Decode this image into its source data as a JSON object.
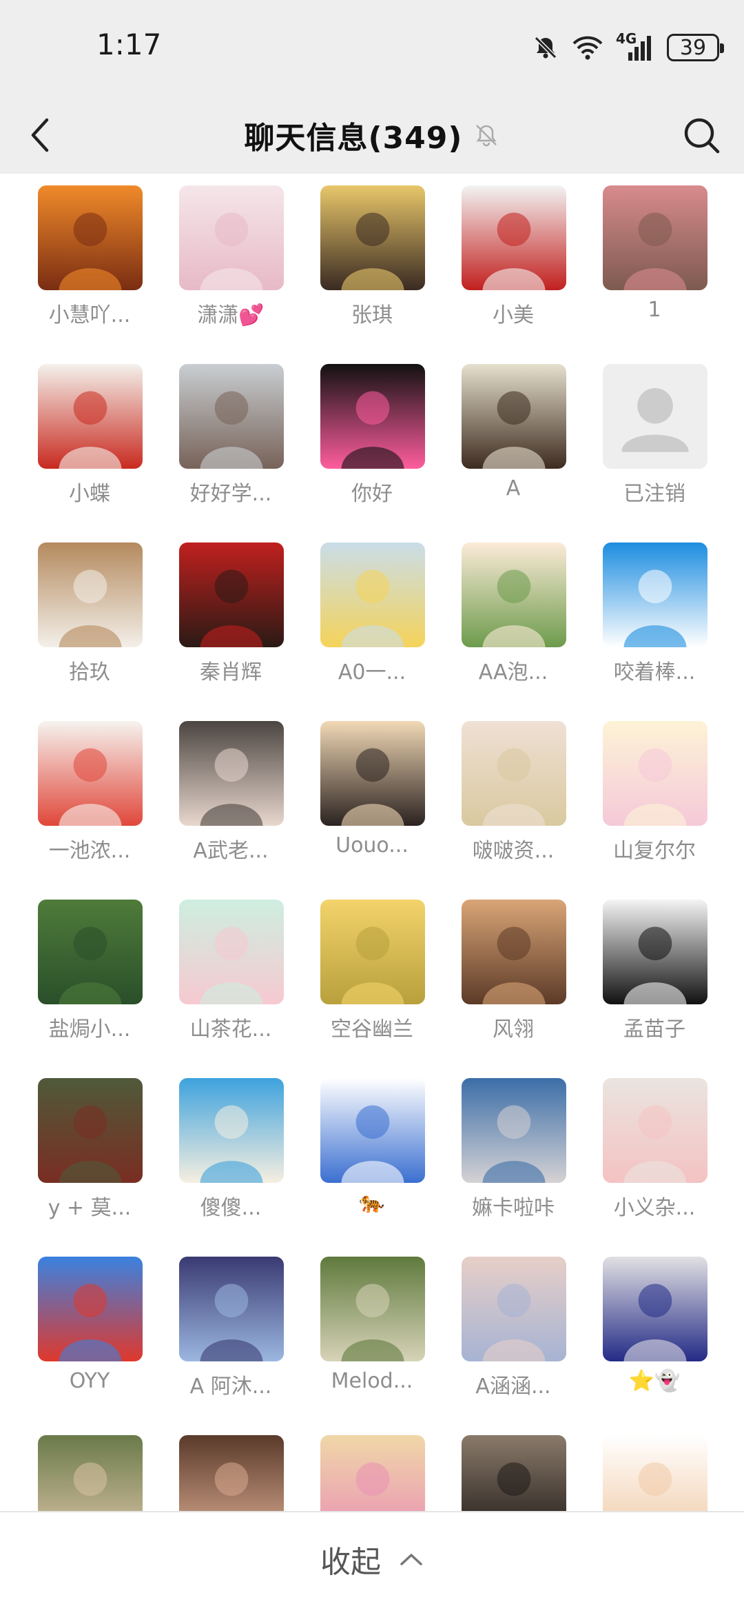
{
  "status_bar": {
    "time": "1:17",
    "network_label": "4G",
    "battery": "39"
  },
  "header": {
    "title": "聊天信息(349)",
    "back_icon": "chevron-left-icon",
    "mute_icon": "bell-off-icon",
    "search_icon": "search-icon"
  },
  "members": [
    {
      "name": "小慧吖...",
      "avatar": "sunset",
      "colors": [
        "#f08a2a",
        "#7a2d12"
      ]
    },
    {
      "name": "潇潇💕",
      "avatar": "girl",
      "colors": [
        "#f5e6ea",
        "#e7b9c7"
      ]
    },
    {
      "name": "张琪",
      "avatar": "cartoon-girl",
      "colors": [
        "#e8c76a",
        "#3a2a22"
      ]
    },
    {
      "name": "小美",
      "avatar": "calligraphy",
      "colors": [
        "#f3f3f3",
        "#c1201e"
      ]
    },
    {
      "name": "1",
      "avatar": "pink-boy",
      "colors": [
        "#d88b8d",
        "#7d5a4f"
      ]
    },
    {
      "name": "小蝶",
      "avatar": "family-red",
      "colors": [
        "#f4f1ec",
        "#c82a1f"
      ]
    },
    {
      "name": "好好学...",
      "avatar": "sea-girl",
      "colors": [
        "#c9ced2",
        "#776258"
      ]
    },
    {
      "name": "你好",
      "avatar": "big-character",
      "colors": [
        "#111111",
        "#ff5d9e"
      ]
    },
    {
      "name": "A",
      "avatar": "sunglasses-girl",
      "colors": [
        "#e6e0ce",
        "#3d2b1f"
      ]
    },
    {
      "name": "已注销",
      "avatar": "default-user",
      "colors": [
        "#eeeeee",
        "#cccccc"
      ]
    },
    {
      "name": "拾玖",
      "avatar": "smile-girl",
      "colors": [
        "#b58a5e",
        "#f3efe9"
      ]
    },
    {
      "name": "秦肖辉",
      "avatar": "family-red-2",
      "colors": [
        "#c0201e",
        "#2b1a15"
      ]
    },
    {
      "name": "A0一...",
      "avatar": "duck",
      "colors": [
        "#c9dde9",
        "#f5d35a"
      ]
    },
    {
      "name": "AA泡...",
      "avatar": "tree",
      "colors": [
        "#fcebd8",
        "#6d9b4c"
      ]
    },
    {
      "name": "咬着棒...",
      "avatar": "doraemon",
      "colors": [
        "#1d8de0",
        "#ffffff"
      ]
    },
    {
      "name": "一池浓...",
      "avatar": "sketch",
      "colors": [
        "#f6f3ef",
        "#e0473a"
      ]
    },
    {
      "name": "A武老...",
      "avatar": "dark-girl",
      "colors": [
        "#4b4541",
        "#e8d7cd"
      ]
    },
    {
      "name": "Uouo...",
      "avatar": "peace-girl",
      "colors": [
        "#f2d9b6",
        "#2b2220"
      ]
    },
    {
      "name": "啵啵资...",
      "avatar": "dress",
      "colors": [
        "#efe0d4",
        "#d9c9a0"
      ]
    },
    {
      "name": "山复尔尔",
      "avatar": "bunny",
      "colors": [
        "#fdf3d6",
        "#f5c9d9"
      ]
    },
    {
      "name": "盐焗小...",
      "avatar": "field",
      "colors": [
        "#4f7b3a",
        "#2a4f2a"
      ]
    },
    {
      "name": "山茶花...",
      "avatar": "braids",
      "colors": [
        "#cdeee0",
        "#f6c9d0"
      ]
    },
    {
      "name": "空谷幽兰",
      "avatar": "wheat",
      "colors": [
        "#f3d36b",
        "#b8a03c"
      ]
    },
    {
      "name": "风翎",
      "avatar": "meditate",
      "colors": [
        "#d9a577",
        "#5c3a27"
      ]
    },
    {
      "name": "孟苗子",
      "avatar": "anime-girl",
      "colors": [
        "#f4f4f4",
        "#111111"
      ]
    },
    {
      "name": "y + 莫...",
      "avatar": "vines",
      "colors": [
        "#4f5a3a",
        "#7a2d22"
      ]
    },
    {
      "name": "傻傻...",
      "avatar": "beach",
      "colors": [
        "#3ea2dd",
        "#f6efe0"
      ]
    },
    {
      "name": "🐅",
      "avatar": "hello-kitty",
      "colors": [
        "#ffffff",
        "#3b6fd0"
      ]
    },
    {
      "name": "嫲卡啦咔",
      "avatar": "lake-girl",
      "colors": [
        "#3c6ea8",
        "#d5d2d4"
      ]
    },
    {
      "name": "小义杂...",
      "avatar": "baby",
      "colors": [
        "#eae4df",
        "#f4c2c2"
      ]
    },
    {
      "name": "OYY",
      "avatar": "doraemon-crab",
      "colors": [
        "#3a82e0",
        "#e0382c"
      ]
    },
    {
      "name": "A 阿沐...",
      "avatar": "blue-hair",
      "colors": [
        "#3a3a72",
        "#9bb7e0"
      ]
    },
    {
      "name": "Melod...",
      "avatar": "garden",
      "colors": [
        "#5f7a3d",
        "#d7d3b8"
      ]
    },
    {
      "name": "A涵涵...",
      "avatar": "butterfly",
      "colors": [
        "#e7cfc8",
        "#a6b3d3"
      ]
    },
    {
      "name": "⭐👻",
      "avatar": "hoodie",
      "colors": [
        "#e2e0e4",
        "#232b86"
      ]
    },
    {
      "name": "",
      "avatar": "hat-girl",
      "colors": [
        "#6a7a4a",
        "#d8c2a3"
      ]
    },
    {
      "name": "",
      "avatar": "portrait",
      "colors": [
        "#5a3a2a",
        "#d8a98f"
      ]
    },
    {
      "name": "",
      "avatar": "cartoon-pink",
      "colors": [
        "#f0d7a8",
        "#e991b5"
      ]
    },
    {
      "name": "",
      "avatar": "dark-pose",
      "colors": [
        "#8a7a6a",
        "#1f1a18"
      ]
    },
    {
      "name": "",
      "avatar": "chibi",
      "colors": [
        "#ffffff",
        "#f1cba7"
      ]
    }
  ],
  "footer": {
    "collapse_label": "收起",
    "collapse_icon": "chevron-up-icon"
  }
}
